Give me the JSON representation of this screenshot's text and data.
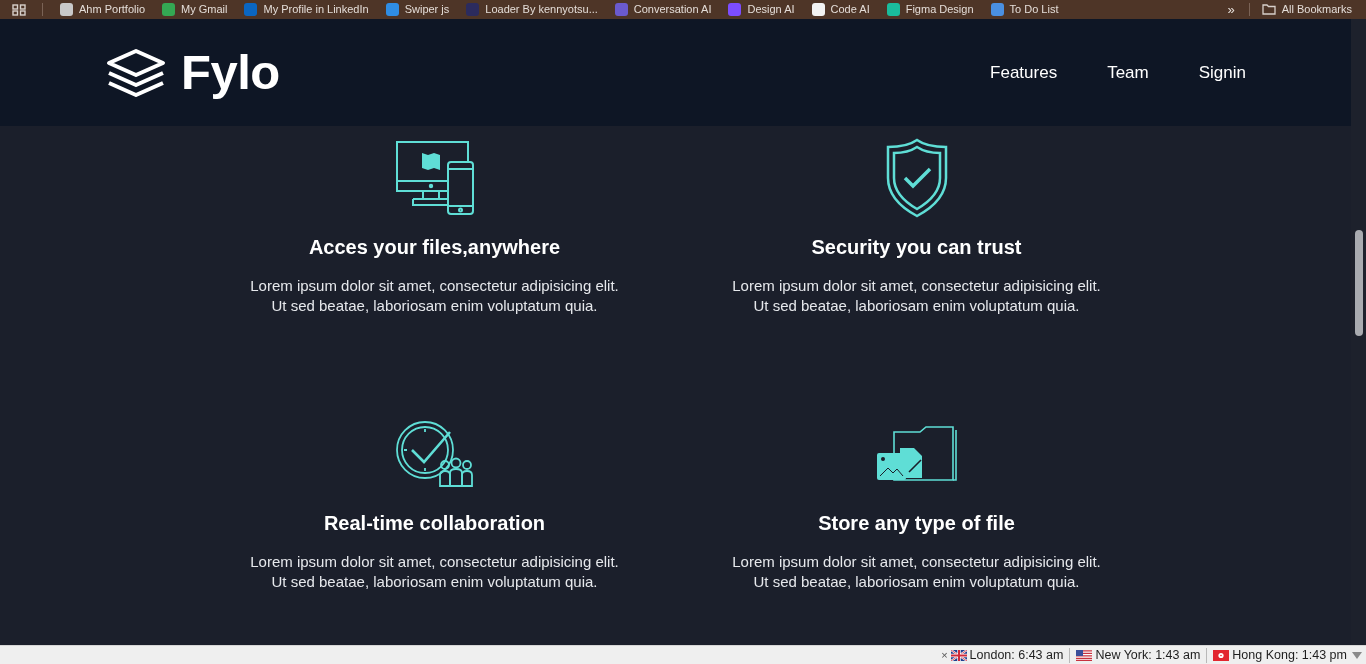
{
  "bookmarks_bar": {
    "items": [
      {
        "label": "Ahm Portfolio",
        "color": "#c9c9c9"
      },
      {
        "label": "My Gmail",
        "color": "#34a853"
      },
      {
        "label": "My Profile in LinkedIn",
        "color": "#0a66c2"
      },
      {
        "label": "Swiper js",
        "color": "#2f8de4"
      },
      {
        "label": "Loader By kennyotsu...",
        "color": "#2b2b5e"
      },
      {
        "label": "Conversation AI",
        "color": "#6a5acd"
      },
      {
        "label": "Design AI",
        "color": "#7c4dff"
      },
      {
        "label": "Code AI",
        "color": "#f2f2f2"
      },
      {
        "label": "Figma Design",
        "color": "#1abc9c"
      },
      {
        "label": "To Do List",
        "color": "#4a90e2"
      }
    ],
    "overflow": "»",
    "all_bookmarks": "All Bookmarks"
  },
  "header": {
    "logo": "Fylo",
    "nav": [
      {
        "label": "Features"
      },
      {
        "label": "Team"
      },
      {
        "label": "Signin"
      }
    ]
  },
  "features": [
    {
      "kind": "devices",
      "title": "Acces your files,anywhere",
      "text": "Lorem ipsum dolor sit amet, consectetur adipisicing elit. Ut sed beatae, laboriosam enim voluptatum quia."
    },
    {
      "kind": "shield",
      "title": "Security you can trust",
      "text": "Lorem ipsum dolor sit amet, consectetur adipisicing elit. Ut sed beatae, laboriosam enim voluptatum quia."
    },
    {
      "kind": "collaboration",
      "title": "Real-time collaboration",
      "text": "Lorem ipsum dolor sit amet, consectetur adipisicing elit. Ut sed beatae, laboriosam enim voluptatum quia."
    },
    {
      "kind": "files",
      "title": "Store any type of file",
      "text": "Lorem ipsum dolor sit amet, consectetur adipisicing elit. Ut sed beatae, laboriosam enim voluptatum quia."
    }
  ],
  "status_bar": {
    "close": "×",
    "clocks": [
      {
        "kind": "uk",
        "label": "London: 6:43 am"
      },
      {
        "kind": "us",
        "label": "New York: 1:43 am"
      },
      {
        "kind": "hk",
        "label": "Hong Kong: 1:43 pm"
      }
    ]
  }
}
